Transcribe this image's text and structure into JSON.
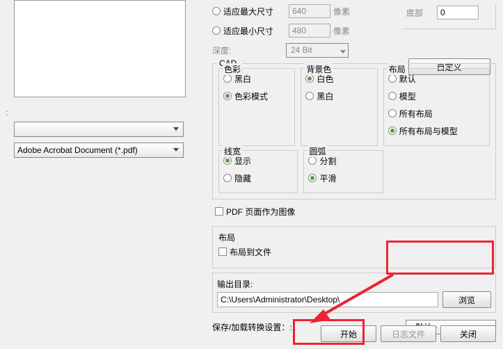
{
  "left": {
    "dropdown1_value": "",
    "dropdown2_value": "Adobe Acrobat Document (*.pdf)"
  },
  "size": {
    "fit_max_label": "适应最大尺寸",
    "fit_max_value": "640",
    "fit_min_label": "适应最小尺寸",
    "fit_min_value": "480",
    "px_unit": "像素",
    "depth_label": "深度:",
    "depth_value": "24 Bit",
    "bottom_label": "底部",
    "bottom_value": "0",
    "customize_btn": "自定义"
  },
  "cad": {
    "fieldset": "CAD",
    "color": {
      "title": "色彩",
      "opt1": "黑白",
      "opt2": "色彩模式"
    },
    "bgcolor": {
      "title": "背景色",
      "opt1": "白色",
      "opt2": "黑白"
    },
    "layout_sel": {
      "title": "布局",
      "opt1": "默认",
      "opt2": "模型",
      "opt3": "所有布局",
      "opt4": "所有布局与模型"
    },
    "linew": {
      "title": "线宽",
      "opt1": "显示",
      "opt2": "隐藏"
    },
    "arc": {
      "title": "圆弧",
      "opt1": "分割",
      "opt2": "平滑"
    }
  },
  "pdf_as_image_label": "PDF 页面作为图像",
  "layout": {
    "title": "布局",
    "to_file_label": "布局到文件"
  },
  "output": {
    "label": "输出目录:",
    "path": "C:\\Users\\Administrator\\Desktop\\",
    "browse_btn": "浏览"
  },
  "save_load": {
    "label": "保存/加载转换设置：:",
    "value": "<默认>"
  },
  "footer": {
    "start_btn": "开始",
    "log_btn": "日志文件",
    "close_btn": "关闭"
  }
}
